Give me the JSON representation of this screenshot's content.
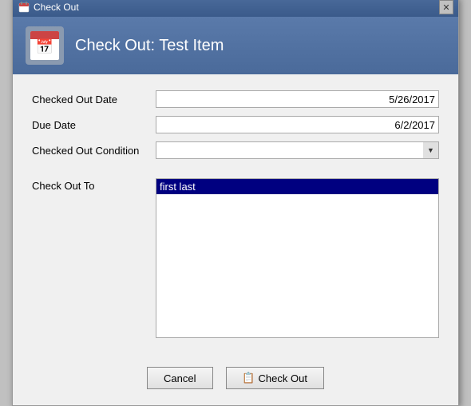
{
  "window": {
    "title": "Check Out",
    "close_label": "✕"
  },
  "header": {
    "title": "Check Out: Test Item",
    "icon_label": "calendar-icon"
  },
  "form": {
    "checked_out_date_label": "Checked Out Date",
    "checked_out_date_value": "5/26/2017",
    "due_date_label": "Due Date",
    "due_date_value": "6/2/2017",
    "checked_out_condition_label": "Checked Out Condition",
    "checked_out_condition_value": "",
    "check_out_to_label": "Check Out To",
    "check_out_to_selected": "first last"
  },
  "buttons": {
    "cancel_label": "Cancel",
    "checkout_label": "Check Out",
    "checkout_icon": "📋"
  }
}
